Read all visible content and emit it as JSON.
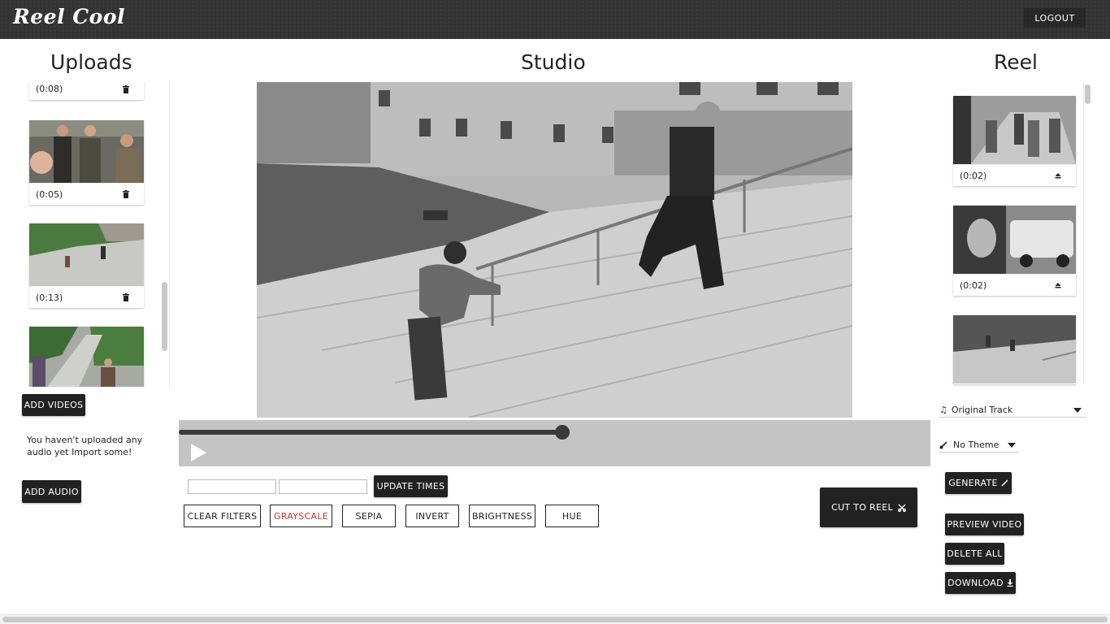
{
  "app": {
    "logo": "Reel Cool",
    "logout_label": "LOGOUT"
  },
  "sections": {
    "uploads": "Uploads",
    "studio": "Studio",
    "reel": "Reel"
  },
  "uploads": {
    "items": [
      {
        "duration": "(0:08)"
      },
      {
        "duration": "(0:05)"
      },
      {
        "duration": "(0:13)"
      },
      {
        "duration": ""
      }
    ],
    "add_videos_label": "ADD VIDEOS",
    "audio_message": "You haven't uploaded any audio yet Import some!",
    "add_audio_label": "ADD AUDIO"
  },
  "studio": {
    "progress_fraction": 0.51,
    "start_time_value": "",
    "end_time_value": "",
    "update_times_label": "UPDATE TIMES",
    "filters": [
      {
        "label": "CLEAR FILTERS"
      },
      {
        "label": "GRAYSCALE",
        "active": true
      },
      {
        "label": "SEPIA"
      },
      {
        "label": "INVERT"
      },
      {
        "label": "BRIGHTNESS"
      },
      {
        "label": "HUE"
      }
    ],
    "cut_to_reel_label": "CUT TO REEL"
  },
  "reel": {
    "items": [
      {
        "duration": "(0:02)"
      },
      {
        "duration": "(0:02)"
      },
      {
        "duration": ""
      }
    ],
    "track_select": {
      "selected": "Original Track"
    },
    "theme_select": {
      "selected": "No Theme"
    },
    "generate_label": "GENERATE",
    "preview_label": "PREVIEW VIDEO",
    "delete_all_label": "DELETE ALL",
    "download_label": "DOWNLOAD"
  },
  "colors": {
    "header_bg": "#333333",
    "button_dark": "#222222",
    "active_filter": "#c0392b",
    "player_bar": "#c4c4c4"
  },
  "icons": [
    "trash-icon",
    "eject-icon",
    "scissors-icon",
    "pencil-icon",
    "download-icon",
    "music-note-icon",
    "brush-icon",
    "play-icon"
  ]
}
